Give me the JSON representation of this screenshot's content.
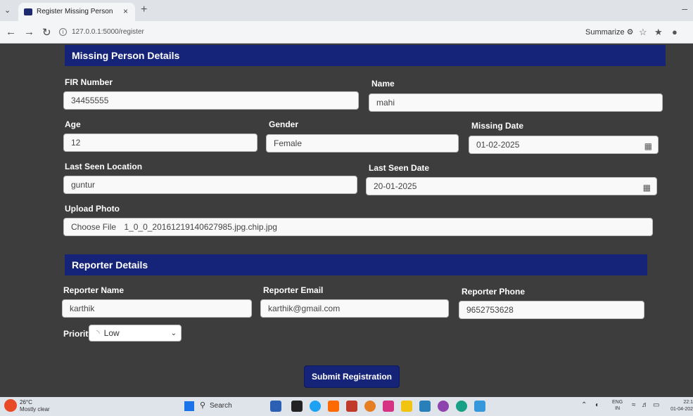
{
  "browser": {
    "tab_title": "Register Missing Person",
    "tab_close": "×",
    "new_tab": "+",
    "url": "127.0.0.1:5000/register",
    "summarize_label": "Summarize"
  },
  "missing_section": {
    "title": "Missing Person Details",
    "fir_label": "FIR Number",
    "fir_value": "34455555",
    "name_label": "Name",
    "name_value": "mahi",
    "age_label": "Age",
    "age_value": "12",
    "gender_label": "Gender",
    "gender_value": "Female",
    "missing_date_label": "Missing Date",
    "missing_date_value": "01-02-2025",
    "last_seen_location_label": "Last Seen Location",
    "last_seen_location_value": "guntur",
    "last_seen_date_label": "Last Seen Date",
    "last_seen_date_value": "20-01-2025",
    "upload_label": "Upload Photo",
    "choose_file_label": "Choose File",
    "file_name": "1_0_0_20161219140627985.jpg.chip.jpg"
  },
  "reporter_section": {
    "title": "Reporter Details",
    "name_label": "Reporter Name",
    "name_value": "karthik",
    "email_label": "Reporter Email",
    "email_value": "karthik@gmail.com",
    "phone_label": "Reporter Phone",
    "phone_value": "9652753628",
    "priority_label": "Priority",
    "priority_value": "Low"
  },
  "submit_label": "Submit Registration",
  "taskbar": {
    "temperature": "26°C",
    "condition": "Mostly clear",
    "search_label": "Search",
    "lang_top": "ENG",
    "lang_bottom": "IN",
    "time": "22:1",
    "date": "01-04-202"
  },
  "colors": {
    "header_blue": "#152479",
    "page_bg": "#3d3d3d"
  }
}
